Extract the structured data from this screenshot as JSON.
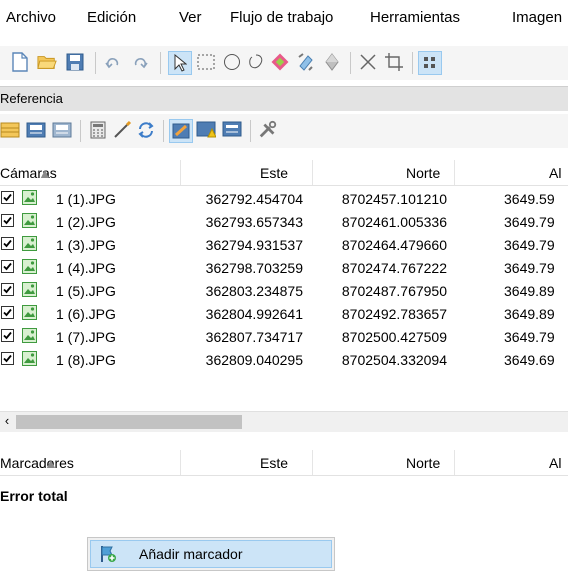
{
  "menu": [
    "Archivo",
    "Edición",
    "Ver",
    "Flujo de trabajo",
    "Herramientas",
    "Imagen"
  ],
  "toolbar_main": {
    "icons": [
      "new-document-icon",
      "open-folder-icon",
      "save-icon",
      "undo-icon",
      "redo-icon",
      "pointer-select-icon",
      "rectangle-select-icon",
      "circle-select-icon",
      "free-form-select-icon",
      "resize-region-icon",
      "rotate-region-icon",
      "navigation-icon",
      "delete-icon",
      "crop-icon",
      "grid-icon"
    ]
  },
  "reference_panel": {
    "title": "Referencia"
  },
  "toolbar_ref": {
    "icons": [
      "import-reference-icon",
      "export-reference-icon",
      "convert-reference-icon",
      "calculator-icon",
      "wand-icon",
      "update-icon",
      "view-source-icon",
      "view-errors-icon",
      "view-estimated-icon",
      "settings-tools-icon"
    ]
  },
  "cameras_table": {
    "headers": [
      "Cámaras",
      "Este",
      "Norte",
      "Al"
    ],
    "rows": [
      {
        "name": "1 (1).JPG",
        "este": "362792.454704",
        "norte": "8702457.101210",
        "alt": "3649.59"
      },
      {
        "name": "1 (2).JPG",
        "este": "362793.657343",
        "norte": "8702461.005336",
        "alt": "3649.79"
      },
      {
        "name": "1 (3).JPG",
        "este": "362794.931537",
        "norte": "8702464.479660",
        "alt": "3649.79"
      },
      {
        "name": "1 (4).JPG",
        "este": "362798.703259",
        "norte": "8702474.767222",
        "alt": "3649.79"
      },
      {
        "name": "1 (5).JPG",
        "este": "362803.234875",
        "norte": "8702487.767950",
        "alt": "3649.89"
      },
      {
        "name": "1 (6).JPG",
        "este": "362804.992641",
        "norte": "8702492.783657",
        "alt": "3649.89"
      },
      {
        "name": "1 (7).JPG",
        "este": "362807.734717",
        "norte": "8702500.427509",
        "alt": "3649.79"
      },
      {
        "name": "1 (8).JPG",
        "este": "362809.040295",
        "norte": "8702504.332094",
        "alt": "3649.69"
      }
    ]
  },
  "markers_table": {
    "headers": [
      "Marcadores",
      "Este",
      "Norte",
      "Al"
    ]
  },
  "error_total": "Error total",
  "context_menu": {
    "item": "Añadir marcador",
    "icon": "add-marker-icon"
  },
  "colors": {
    "toolbar_bg": "#f5f5f5",
    "panel_header": "#e3e3e3",
    "selection": "#cce4f7",
    "selection_border": "#99c9ef"
  }
}
